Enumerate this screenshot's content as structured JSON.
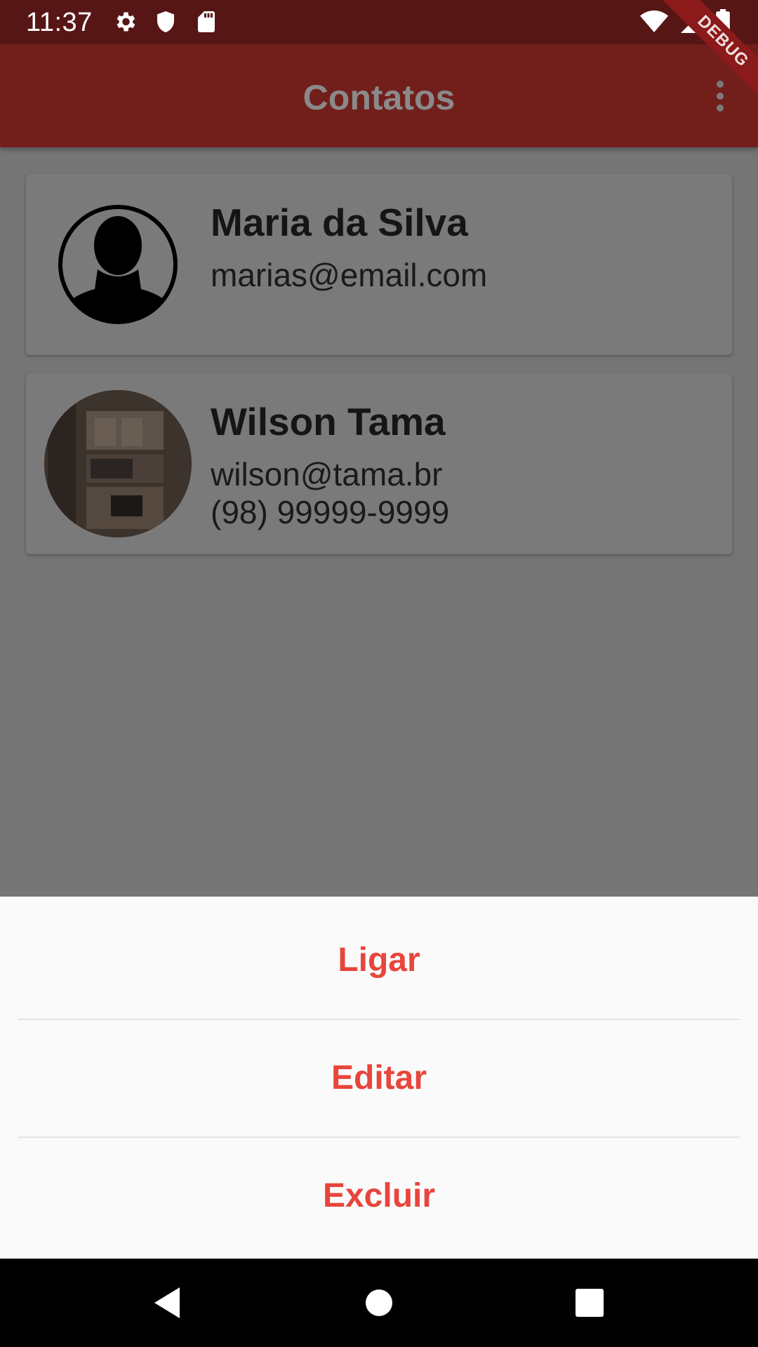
{
  "status_bar": {
    "time": "11:37",
    "left_icons": [
      "gear-icon",
      "shield-icon",
      "sd-card-icon"
    ],
    "right_icons": [
      "wifi-icon",
      "signal-icon",
      "battery-icon"
    ]
  },
  "debug_banner": "DEBUG",
  "app_bar": {
    "title": "Contatos",
    "menu_icon": "more-vert-icon"
  },
  "contacts": [
    {
      "name": "Maria da Silva",
      "email": "marias@email.com",
      "phone": "",
      "avatar": "person-silhouette-icon"
    },
    {
      "name": "Wilson Tama",
      "email": "wilson@tama.br",
      "phone": "(98) 99999-9999",
      "avatar": "photo"
    }
  ],
  "action_sheet": {
    "options": [
      {
        "label": "Ligar"
      },
      {
        "label": "Editar"
      },
      {
        "label": "Excluir"
      }
    ]
  },
  "nav_bar": {
    "icons": [
      "back-icon",
      "home-icon",
      "recents-icon"
    ]
  },
  "colors": {
    "status_bar": "#571616",
    "app_bar": "#721f1c",
    "scrim_background": "#757575",
    "sheet_background": "#fafafa",
    "action_text": "#e8453c"
  }
}
